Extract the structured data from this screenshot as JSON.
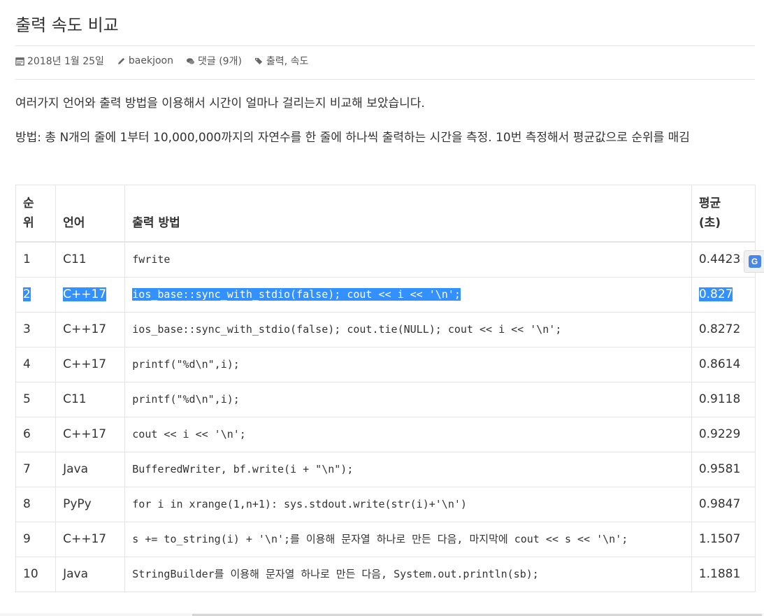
{
  "post": {
    "title": "출력 속도 비교",
    "date": "2018년 1월 25일",
    "author": "baekjoon",
    "comments": "댓글 (9개)",
    "tags": "출력, 속도",
    "intro": "여러가지 언어와 출력 방법을 이용해서 시간이 얼마나 걸리는지 비교해 보았습니다.",
    "method": "방법: 총 N개의 줄에 1부터 10,000,000까지의 자연수를 한 줄에 하나씩 출력하는 시간을 측정. 10번 측정해서 평균값으로 순위를 매김"
  },
  "table": {
    "headers": [
      "순위",
      "언어",
      "출력 방법",
      "평균(초)"
    ],
    "rows": [
      {
        "rank": "1",
        "lang": "C11",
        "method": "fwrite",
        "avg": "0.4423"
      },
      {
        "rank": "2",
        "lang": "C++17",
        "method": "ios_base::sync_with_stdio(false); cout << i << '\\n';",
        "avg": "0.827"
      },
      {
        "rank": "3",
        "lang": "C++17",
        "method": "ios_base::sync_with_stdio(false); cout.tie(NULL); cout << i << '\\n';",
        "avg": "0.8272"
      },
      {
        "rank": "4",
        "lang": "C++17",
        "method": "printf(\"%d\\n\",i);",
        "avg": "0.8614"
      },
      {
        "rank": "5",
        "lang": "C11",
        "method": "printf(\"%d\\n\",i);",
        "avg": "0.9118"
      },
      {
        "rank": "6",
        "lang": "C++17",
        "method": "cout << i << '\\n';",
        "avg": "0.9229"
      },
      {
        "rank": "7",
        "lang": "Java",
        "method": "BufferedWriter, bf.write(i + \"\\n\");",
        "avg": "0.9581"
      },
      {
        "rank": "8",
        "lang": "PyPy",
        "method": "for i in xrange(1,n+1): sys.stdout.write(str(i)+'\\n')",
        "avg": "0.9847"
      },
      {
        "rank": "9",
        "lang": "C++17",
        "method": "s += to_string(i) + '\\n';를 이용해 문자열 하나로 만든 다음, 마지막에 cout << s << '\\n';",
        "avg": "1.1507"
      },
      {
        "rank": "10",
        "lang": "Java",
        "method": "StringBuilder를 이용해 문자열 하나로 만든 다음, System.out.println(sb);",
        "avg": "1.1881"
      }
    ]
  },
  "translate_widget": {
    "icon": "google-translate-icon",
    "glyph": "G"
  },
  "colors": {
    "selection": "#3390ff",
    "border": "#e5e5e5",
    "text": "#333333"
  }
}
